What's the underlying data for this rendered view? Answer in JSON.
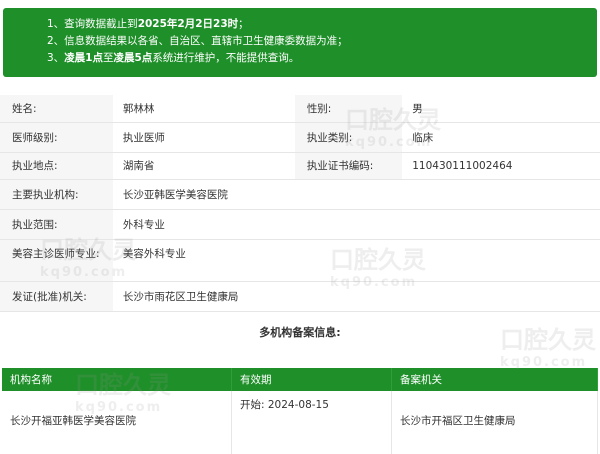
{
  "notice": {
    "line1_prefix": "1、查询数据截止到",
    "line1_date": "2025年2月2日23时",
    "line1_suffix": "；",
    "line2": "2、信息数据结果以各省、自治区、直辖市卫生健康委数据为准；",
    "line3_prefix": "3、",
    "line3_time1": "凌晨1点",
    "line3_mid": "至",
    "line3_time2": "凌晨5点",
    "line3_suffix": "系统进行维护，不能提供查询。"
  },
  "info": {
    "name_label": "姓名:",
    "name_value": "郭林林",
    "gender_label": "性别:",
    "gender_value": "男",
    "level_label": "医师级别:",
    "level_value": "执业医师",
    "category_label": "执业类别:",
    "category_value": "临床",
    "location_label": "执业地点:",
    "location_value": "湖南省",
    "cert_label": "执业证书编码:",
    "cert_value": "110430111002464",
    "org_label": "主要执业机构:",
    "org_value": "长沙亚韩医学美容医院",
    "scope_label": "执业范围:",
    "scope_value": "外科专业",
    "cosmetic_label": "美容主诊医师专业:",
    "cosmetic_value": "美容外科专业",
    "issuer_label": "发证(批准)机关:",
    "issuer_value": "长沙市雨花区卫生健康局"
  },
  "multi": {
    "title": "多机构备案信息:",
    "headers": [
      "机构名称",
      "有效期",
      "备案机关"
    ],
    "rows": [
      {
        "org": "长沙开福亚韩医学美容医院",
        "valid_start": "开始: 2024-08-15",
        "authority": "长沙市开福区卫生健康局"
      }
    ]
  },
  "watermark": {
    "text": "口腔久灵",
    "sub": "kq90.com"
  }
}
